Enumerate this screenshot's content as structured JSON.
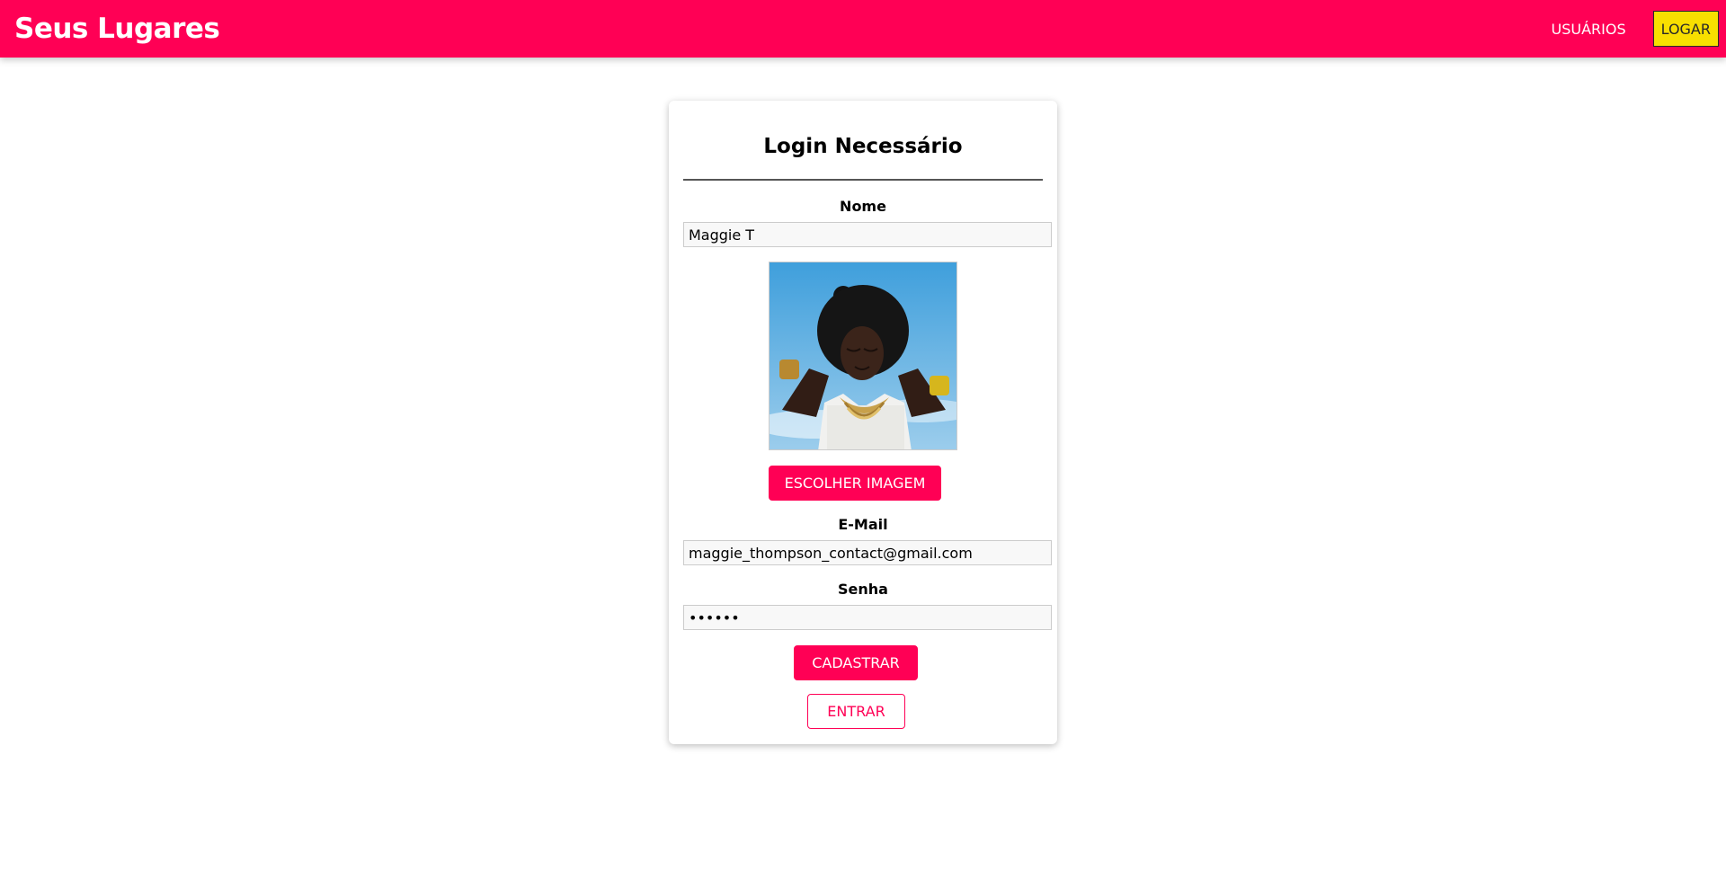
{
  "header": {
    "brand": "Seus Lugares",
    "nav": {
      "users_label": "USUÁRIOS",
      "login_label": "LOGAR"
    }
  },
  "form": {
    "title": "Login Necessário",
    "name": {
      "label": "Nome",
      "value": "Maggie T"
    },
    "image": {
      "button_label": "ESCOLHER IMAGEM"
    },
    "email": {
      "label": "E-Mail",
      "value": "maggie_thompson_contact@gmail.com"
    },
    "password": {
      "label": "Senha",
      "value": "••••••"
    },
    "submit_label": "CADASTRAR",
    "switch_label": "ENTRAR"
  },
  "colors": {
    "primary": "#ff0055",
    "login_button": "#f8df00",
    "text": "#000000"
  }
}
